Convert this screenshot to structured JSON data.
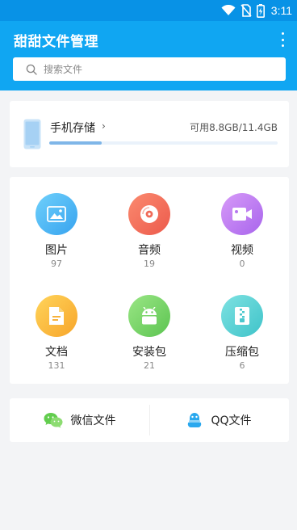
{
  "status_bar": {
    "time": "3:11",
    "icons": [
      "wifi-icon",
      "no-sim-icon",
      "battery-charging-icon"
    ]
  },
  "app_bar": {
    "title": "甜甜文件管理",
    "menu_icon": "more-vert-icon"
  },
  "search": {
    "placeholder": "搜索文件",
    "value": ""
  },
  "storage": {
    "title": "手机存储",
    "chevron": "›",
    "usage": "可用8.8GB/11.4GB",
    "used_fraction": 0.23
  },
  "categories": [
    {
      "label": "图片",
      "count": "97",
      "icon": "image-icon",
      "color": "#4fb8f5"
    },
    {
      "label": "音频",
      "count": "19",
      "icon": "music-disc-icon",
      "color": "#f26e5c"
    },
    {
      "label": "视频",
      "count": "0",
      "icon": "video-camera-icon",
      "color": "#c17ef0"
    },
    {
      "label": "文档",
      "count": "131",
      "icon": "document-icon",
      "color": "#fbb83a"
    },
    {
      "label": "安装包",
      "count": "21",
      "icon": "android-icon",
      "color": "#7ad56a"
    },
    {
      "label": "压缩包",
      "count": "6",
      "icon": "zip-file-icon",
      "color": "#58d3d6"
    }
  ],
  "shares": [
    {
      "label": "微信文件",
      "icon": "wechat-icon",
      "color": "#4cc64a"
    },
    {
      "label": "QQ文件",
      "icon": "qq-icon",
      "color": "#2aa4ea"
    }
  ]
}
